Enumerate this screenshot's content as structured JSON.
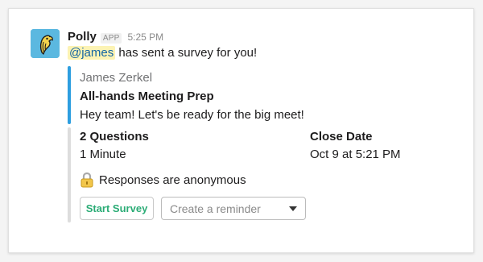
{
  "app": {
    "name": "Polly",
    "badge": "APP",
    "time": "5:25 PM",
    "icon": "polly-parrot-logo"
  },
  "message": {
    "mention": "@james",
    "text": "has sent a survey for you!"
  },
  "attachment": {
    "author": "James Zerkel",
    "title": "All-hands Meeting Prep",
    "body": "Hey team! Let's be ready for the big meet!",
    "accent_color": "#2d9ee0"
  },
  "fields": [
    {
      "label": "2 Questions",
      "value": "1 Minute"
    },
    {
      "label": "Close Date",
      "value": "Oct 9 at 5:21 PM"
    }
  ],
  "anonymous": {
    "icon": "lock-icon",
    "text": "Responses are anonymous"
  },
  "actions": {
    "start_label": "Start Survey",
    "start_color": "#2bac76",
    "reminder_placeholder": "Create a reminder"
  }
}
